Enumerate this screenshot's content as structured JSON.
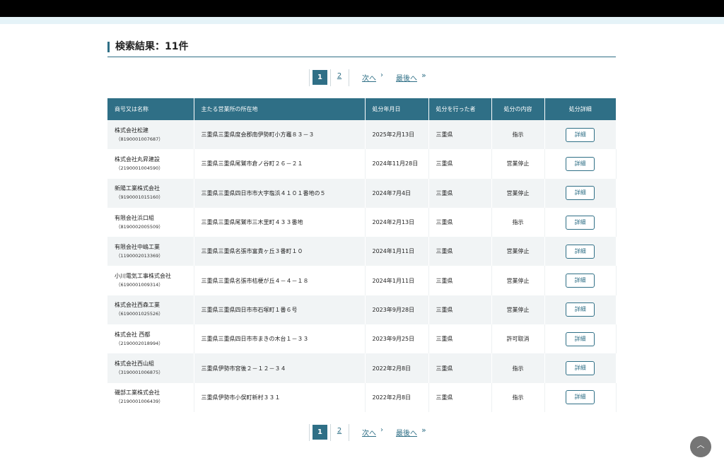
{
  "heading": {
    "title": "検索結果：11件"
  },
  "pagination": {
    "current": "1",
    "page2": "2",
    "next_label": "次へ",
    "next_icon": "›",
    "last_label": "最後へ",
    "last_icon": "»"
  },
  "table": {
    "headers": [
      "商号又は名称",
      "主たる営業所の所在地",
      "処分年月日",
      "処分を行った者",
      "処分の内容",
      "処分詳細"
    ],
    "rows": [
      {
        "name": "株式会社松建",
        "number": "（8190001007687）",
        "address": "三重県三重県度会郡南伊勢町小方竈８３－３",
        "date": "2025年2月13日",
        "authority": "三重県",
        "content": "指示",
        "detail": "詳細"
      },
      {
        "name": "株式会社丸昇建設",
        "number": "（2190001004590）",
        "address": "三重県三重県尾鷲市倉ノ谷町２６－２１",
        "date": "2024年11月28日",
        "authority": "三重県",
        "content": "営業停止",
        "detail": "詳細"
      },
      {
        "name": "新陽工業株式会社",
        "number": "（9190001015160）",
        "address": "三重県三重県四日市市大字塩浜４１０１番地の５",
        "date": "2024年7月4日",
        "authority": "三重県",
        "content": "営業停止",
        "detail": "詳細"
      },
      {
        "name": "有限会社浜口組",
        "number": "（8190002005509）",
        "address": "三重県三重県尾鷲市三木里町４３３番地",
        "date": "2024年2月13日",
        "authority": "三重県",
        "content": "指示",
        "detail": "詳細"
      },
      {
        "name": "有限会社中嶋工業",
        "number": "（1190002013369）",
        "address": "三重県三重県名張市富貴ヶ丘３番町１０",
        "date": "2024年1月11日",
        "authority": "三重県",
        "content": "営業停止",
        "detail": "詳細"
      },
      {
        "name": "小川電気工事株式会社",
        "number": "（6190001009314）",
        "address": "三重県三重県名張市桔梗が丘４－４－１８",
        "date": "2024年1月11日",
        "authority": "三重県",
        "content": "営業停止",
        "detail": "詳細"
      },
      {
        "name": "株式会社西森工業",
        "number": "（6190001025526）",
        "address": "三重県三重県四日市市石塚町１番６号",
        "date": "2023年9月28日",
        "authority": "三重県",
        "content": "営業停止",
        "detail": "詳細"
      },
      {
        "name": "株式会社 西都",
        "number": "（2190002018994）",
        "address": "三重県三重県四日市市まきの木台１－３３",
        "date": "2023年9月25日",
        "authority": "三重県",
        "content": "許可取消",
        "detail": "詳細"
      },
      {
        "name": "株式会社西山組",
        "number": "（3190001006875）",
        "address": "三重県伊勢市宮後２－１２－３４",
        "date": "2022年2月8日",
        "authority": "三重県",
        "content": "指示",
        "detail": "詳細"
      },
      {
        "name": "磯部工業株式会社",
        "number": "（2190001006439）",
        "address": "三重県伊勢市小俣町新村３３１",
        "date": "2022年2月8日",
        "authority": "三重県",
        "content": "指示",
        "detail": "詳細"
      }
    ]
  },
  "back_to_top": {
    "icon": "chevron-up-icon",
    "glyph": "︿"
  },
  "colors": {
    "accent": "#2f6f86",
    "header_bg": "#2f6f86",
    "row_alt": "#f1f4f5",
    "topbar": "#000000",
    "subbar": "#e5f3f8"
  }
}
